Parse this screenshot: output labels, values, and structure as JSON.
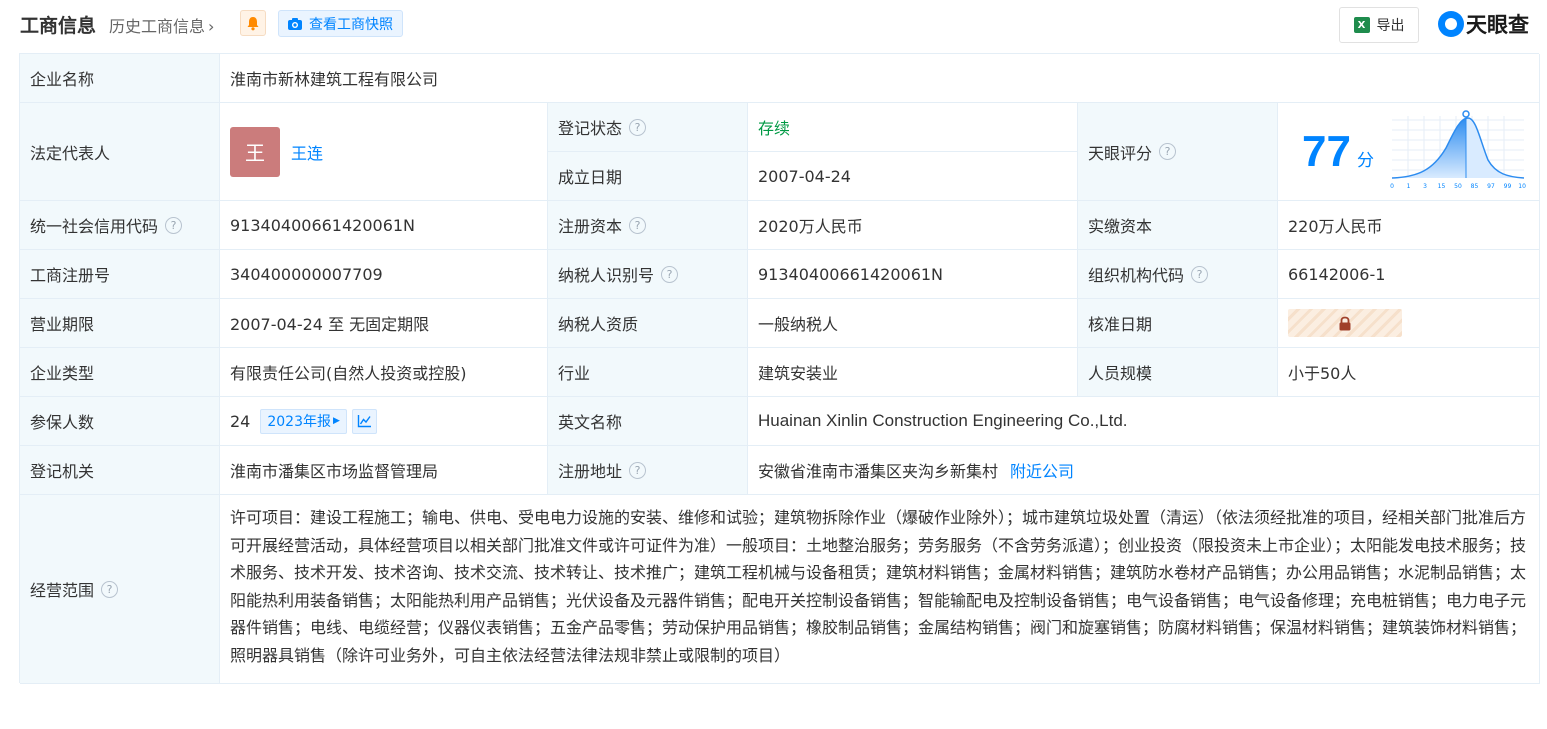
{
  "header": {
    "title": "工商信息",
    "history": "历史工商信息",
    "snapshot_label": "查看工商快照",
    "export_label": "导出",
    "brand": "天眼查"
  },
  "company": {
    "name_label": "企业名称",
    "name": "淮南市新林建筑工程有限公司",
    "legal_rep_label": "法定代表人",
    "legal_rep_avatar": "王",
    "legal_rep": "王连",
    "reg_status_label": "登记状态",
    "reg_status": "存续",
    "found_date_label": "成立日期",
    "found_date": "2007-04-24",
    "score_label": "天眼评分",
    "score": "77",
    "score_unit": "分",
    "credit_code_label": "统一社会信用代码",
    "credit_code": "91340400661420061N",
    "reg_capital_label": "注册资本",
    "reg_capital": "2020万人民币",
    "paid_capital_label": "实缴资本",
    "paid_capital": "220万人民币",
    "reg_no_label": "工商注册号",
    "reg_no": "340400000007709",
    "taxpayer_id_label": "纳税人识别号",
    "taxpayer_id": "91340400661420061N",
    "org_code_label": "组织机构代码",
    "org_code": "66142006-1",
    "term_label": "营业期限",
    "term": "2007-04-24 至 无固定期限",
    "taxpayer_qual_label": "纳税人资质",
    "taxpayer_qual": "一般纳税人",
    "approve_date_label": "核准日期",
    "type_label": "企业类型",
    "type": "有限责任公司(自然人投资或控股)",
    "industry_label": "行业",
    "industry": "建筑安装业",
    "staff_size_label": "人员规模",
    "staff_size": "小于50人",
    "insured_label": "参保人数",
    "insured": "24",
    "insured_report": "2023年报",
    "english_name_label": "英文名称",
    "english_name": "Huainan Xinlin Construction Engineering Co.,Ltd.",
    "authority_label": "登记机关",
    "authority": "淮南市潘集区市场监督管理局",
    "address_label": "注册地址",
    "address": "安徽省淮南市潘集区夹沟乡新集村",
    "nearby_label": "附近公司",
    "scope_label": "经营范围",
    "scope": "许可项目：建设工程施工；输电、供电、受电电力设施的安装、维修和试验；建筑物拆除作业（爆破作业除外）；城市建筑垃圾处置（清运）（依法须经批准的项目，经相关部门批准后方可开展经营活动，具体经营项目以相关部门批准文件或许可证件为准）一般项目：土地整治服务；劳务服务（不含劳务派遣）；创业投资（限投资未上市企业）；太阳能发电技术服务；技术服务、技术开发、技术咨询、技术交流、技术转让、技术推广；建筑工程机械与设备租赁；建筑材料销售；金属材料销售；建筑防水卷材产品销售；办公用品销售；水泥制品销售；太阳能热利用装备销售；太阳能热利用产品销售；光伏设备及元器件销售；配电开关控制设备销售；智能输配电及控制设备销售；电气设备销售；电气设备修理；充电桩销售；电力电子元器件销售；电线、电缆经营；仪器仪表销售；五金产品零售；劳动保护用品销售；橡胶制品销售；金属结构销售；阀门和旋塞销售；防腐材料销售；保温材料销售；建筑装饰材料销售；照明器具销售（除许可业务外，可自主依法经营法律法规非禁止或限制的项目）"
  },
  "score_axis": [
    "0",
    "1",
    "3",
    "15",
    "50",
    "85",
    "97",
    "99",
    "100"
  ],
  "colors": {
    "accent": "#0084ff",
    "label_bg": "#f2f9fc",
    "border": "#e4eef6",
    "status_green": "#009944",
    "avatar": "#cb7c7c"
  }
}
